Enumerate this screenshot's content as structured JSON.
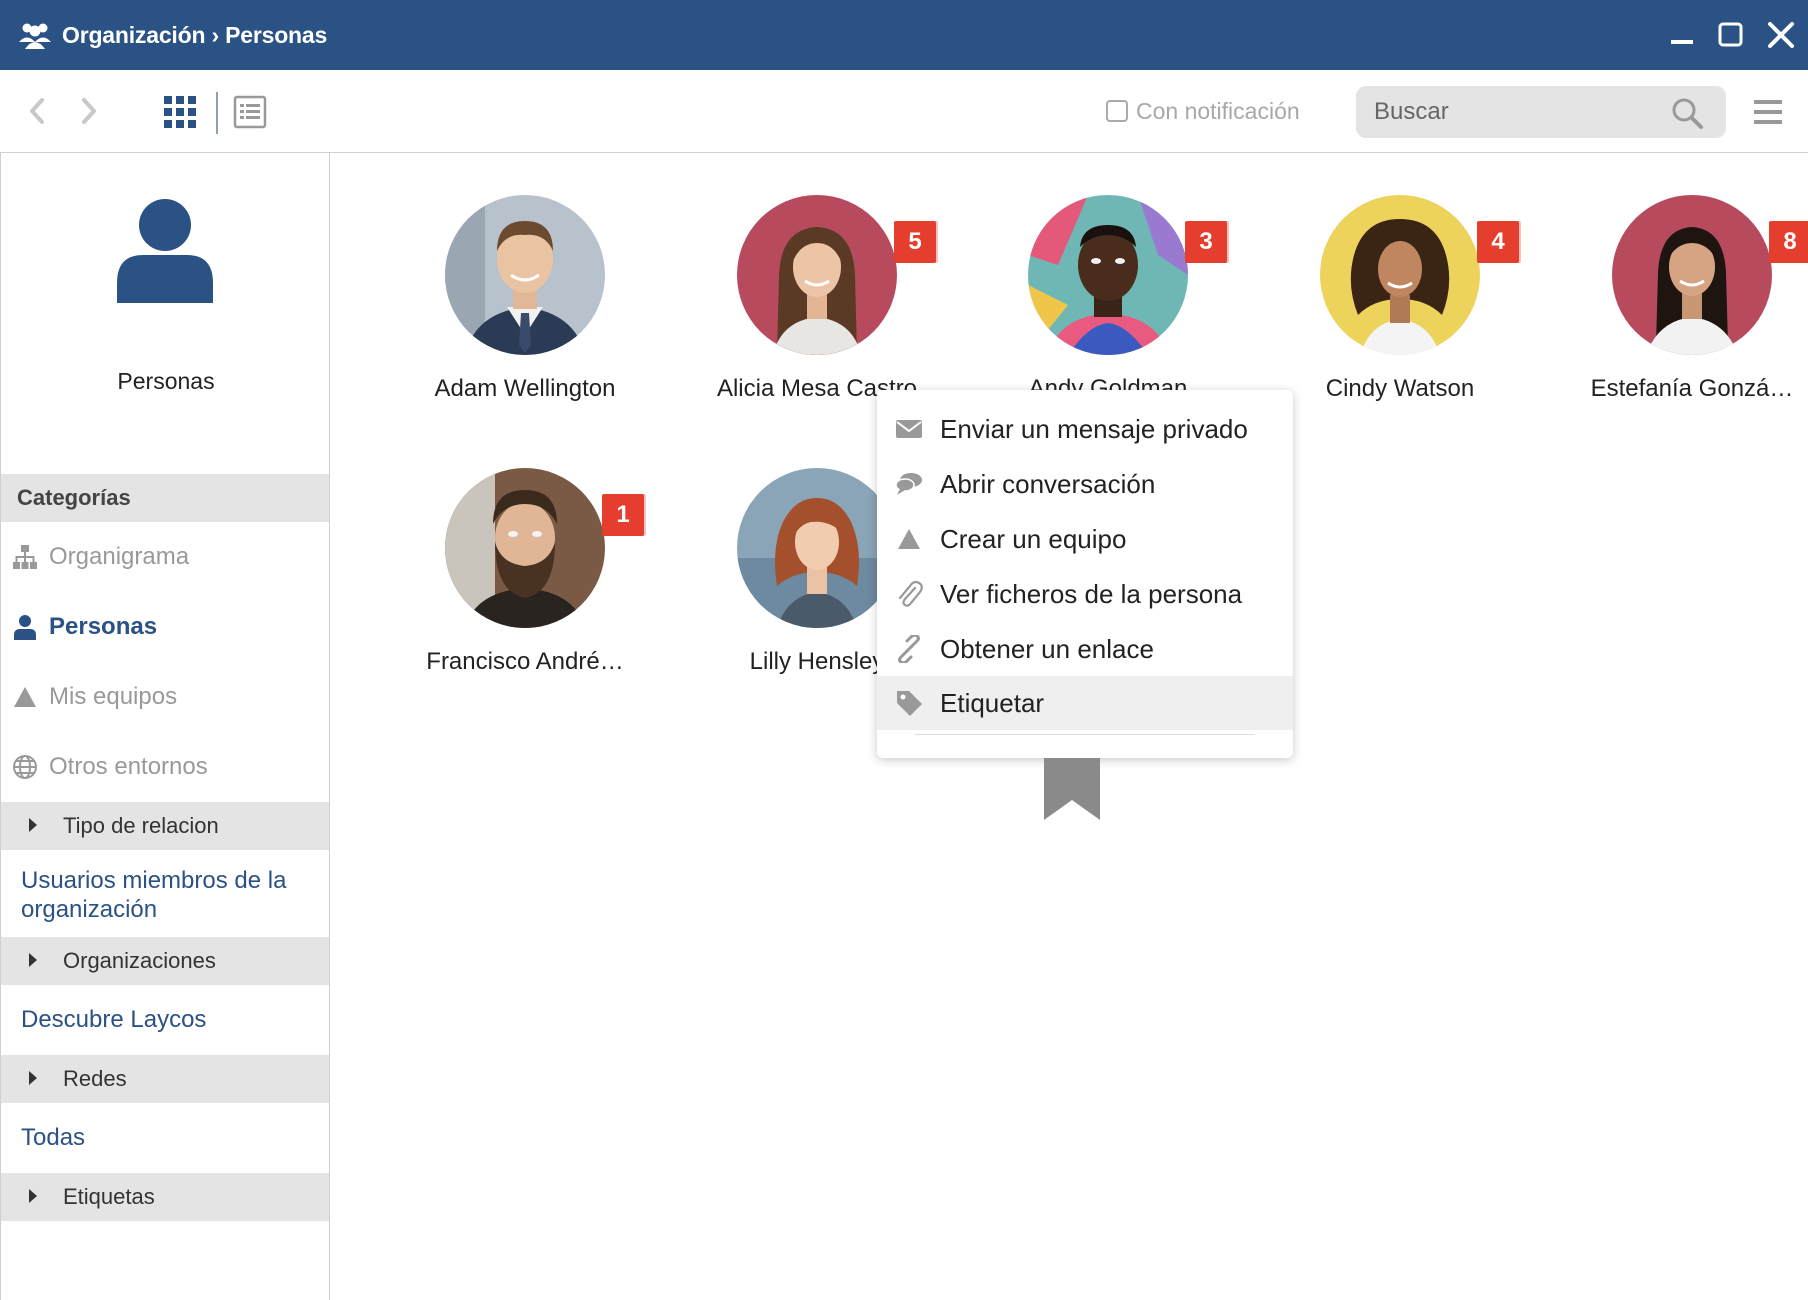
{
  "window": {
    "title": "Organización › Personas",
    "accent": "#2b5284"
  },
  "toolbar": {
    "notification_label": "Con notificación",
    "search_placeholder": "Buscar"
  },
  "sidebar": {
    "hero_label": "Personas",
    "section_title": "Categorías",
    "nav": [
      {
        "label": "Organigrama",
        "icon": "sitemap-icon"
      },
      {
        "label": "Personas",
        "icon": "user-icon",
        "active": true
      },
      {
        "label": "Mis equipos",
        "icon": "triangle-icon"
      },
      {
        "label": "Otros entornos",
        "icon": "globe-icon"
      }
    ],
    "groups": [
      {
        "label": "Tipo de relacion",
        "link": "Usuarios miembros de la organización"
      },
      {
        "label": "Organizaciones",
        "link": "Descubre Laycos"
      },
      {
        "label": "Redes",
        "link": "Todas"
      },
      {
        "label": "Etiquetas"
      }
    ]
  },
  "people": [
    {
      "name": "Adam Wellington",
      "badge": null
    },
    {
      "name": "Alicia Mesa Castro",
      "badge": "5"
    },
    {
      "name": "Andy Goldman",
      "badge": "3"
    },
    {
      "name": "Cindy Watson",
      "badge": "4"
    },
    {
      "name": "Estefanía Gonzá…",
      "badge": "8"
    },
    {
      "name": "Francisco André…",
      "badge": "1"
    },
    {
      "name": "Lilly Hensley",
      "badge": ""
    }
  ],
  "context_menu": {
    "items": [
      {
        "label": "Enviar un mensaje privado",
        "icon": "envelope-icon"
      },
      {
        "label": "Abrir conversación",
        "icon": "chat-bubbles-icon"
      },
      {
        "label": "Crear un equipo",
        "icon": "triangle-icon"
      },
      {
        "label": "Ver ficheros de la persona",
        "icon": "paperclip-icon"
      },
      {
        "label": "Obtener un enlace",
        "icon": "link-icon"
      },
      {
        "label": "Etiquetar",
        "icon": "tag-icon",
        "highlighted": true
      }
    ]
  },
  "colors": {
    "badge": "#e53e2e",
    "sidebar_section_bg": "#e4e4e4",
    "link": "#2b5284"
  }
}
